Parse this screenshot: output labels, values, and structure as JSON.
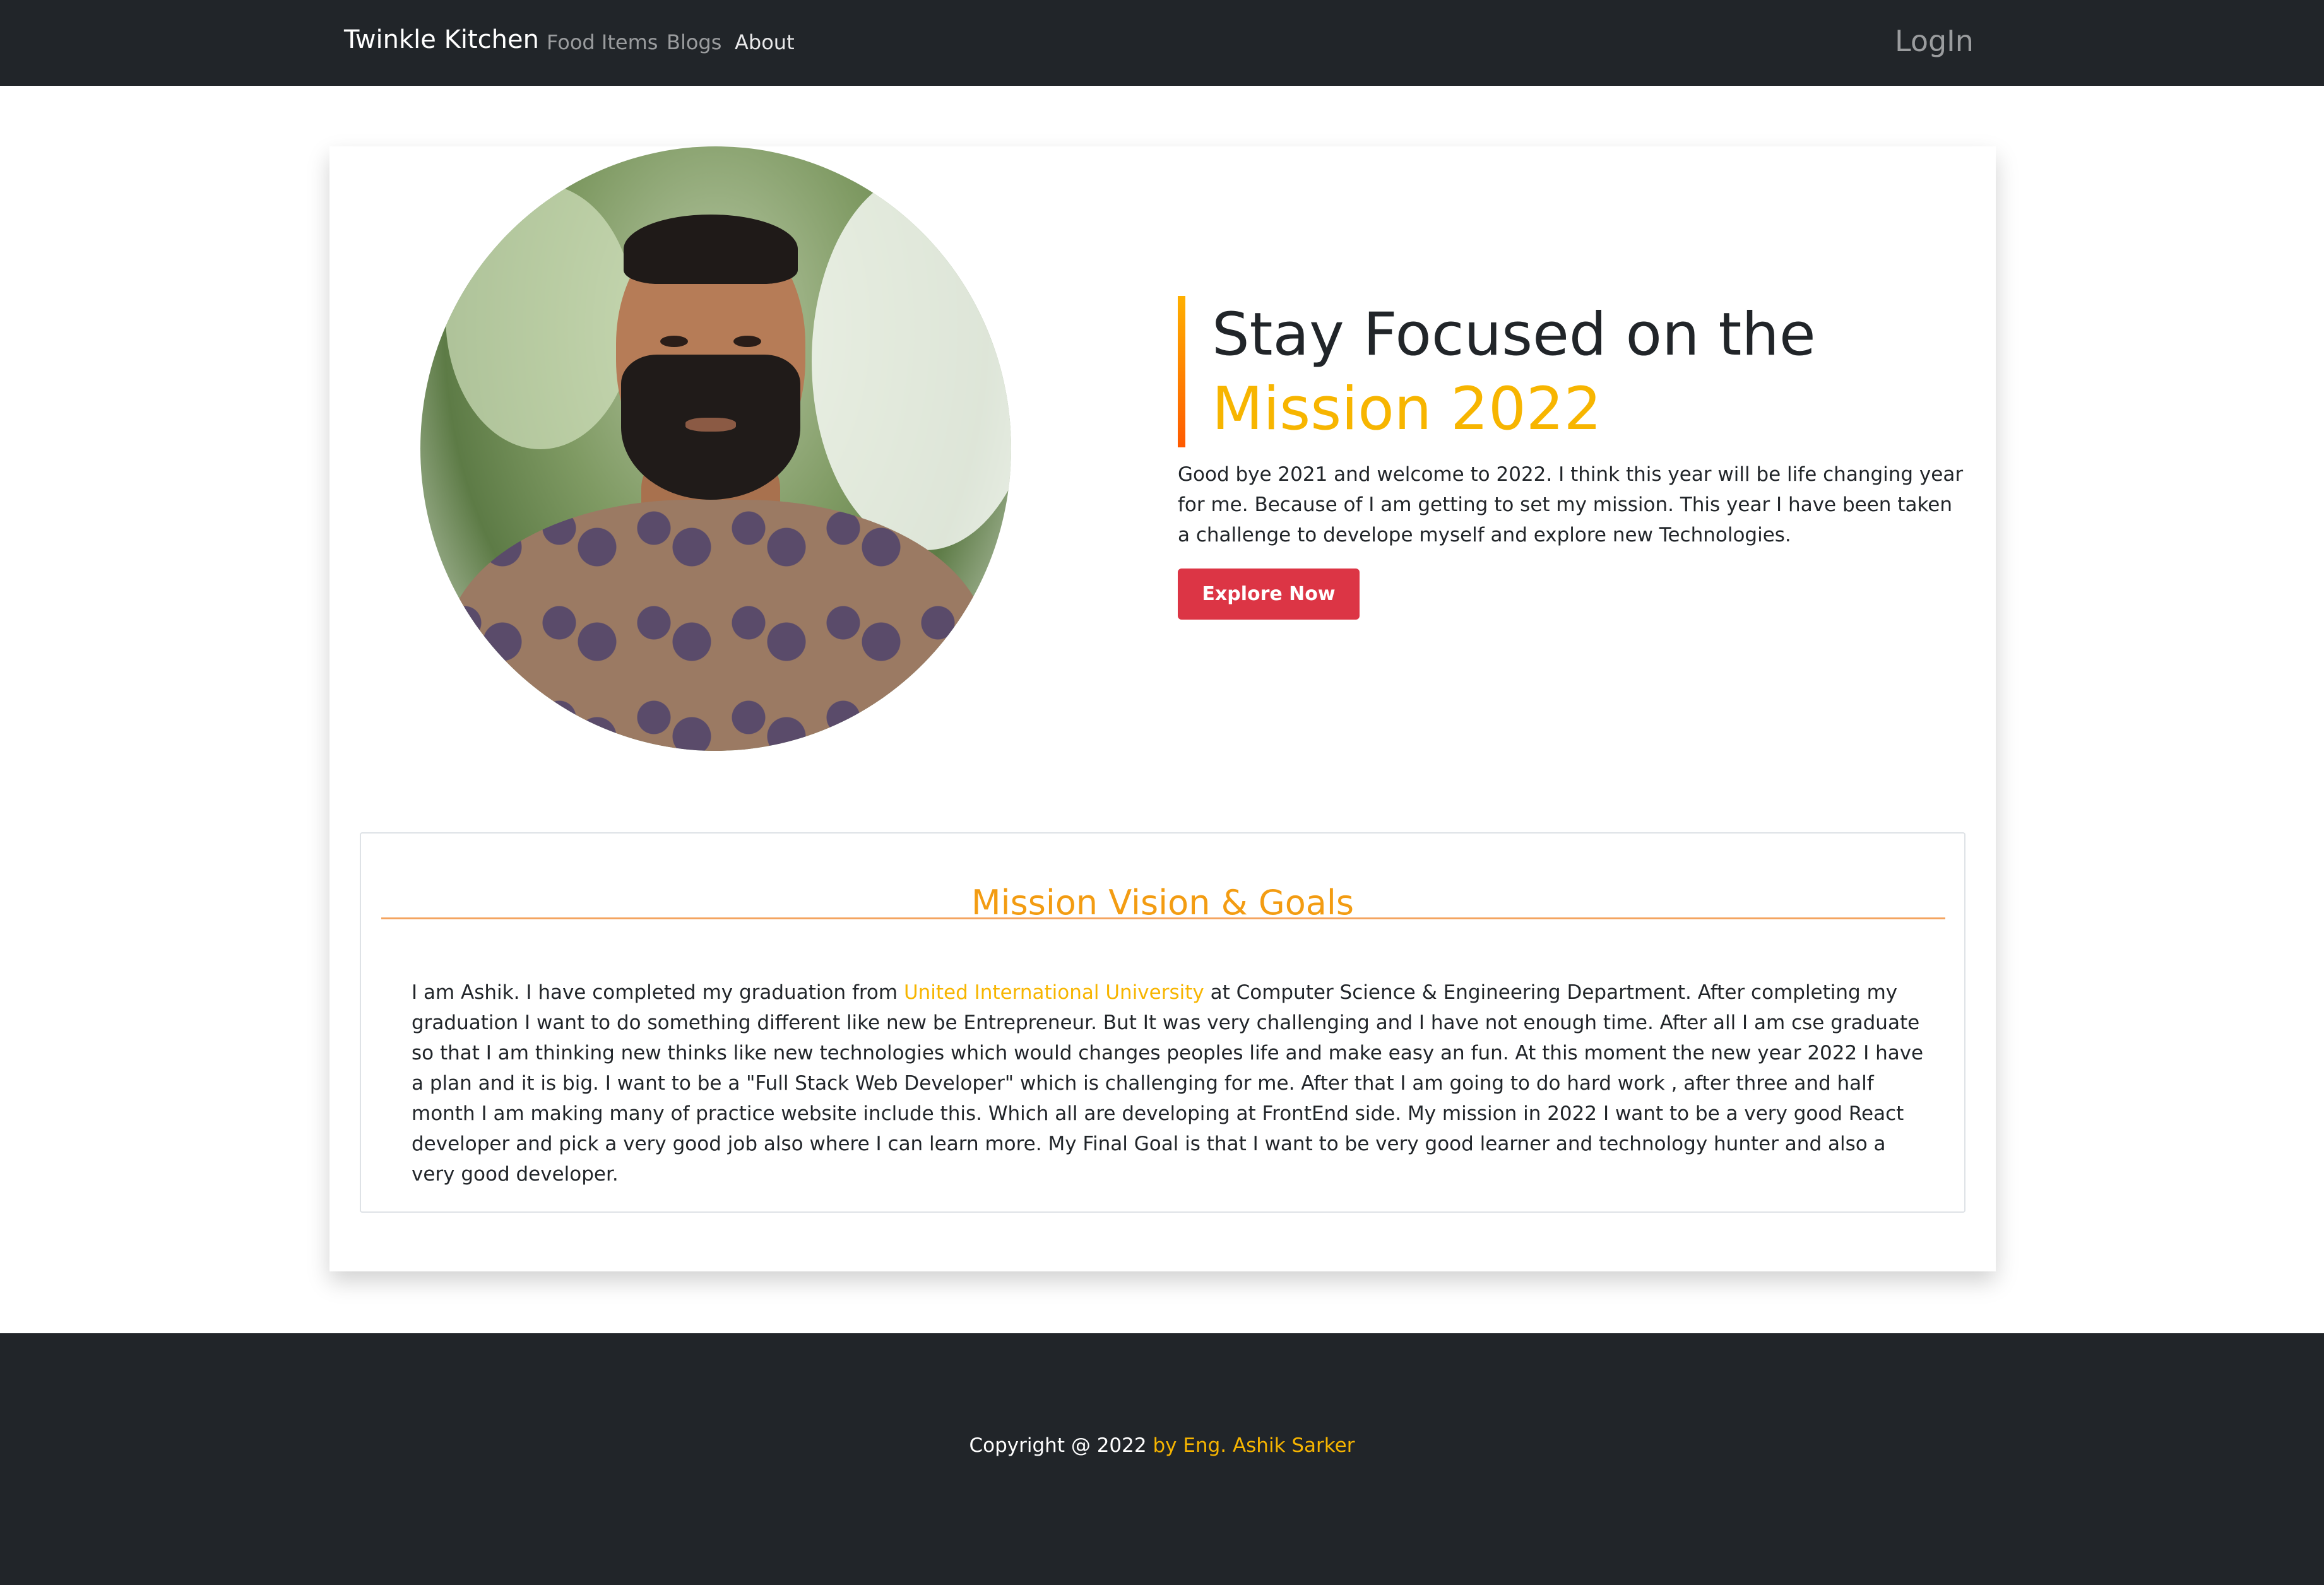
{
  "navbar": {
    "brand": "Twinkle Kitchen",
    "links": [
      "Food Items",
      "Blogs",
      "About"
    ],
    "login": "LogIn"
  },
  "hero": {
    "heading_line1": "Stay Focused on the",
    "heading_line2": "Mission 2022",
    "text": "Good bye 2021 and welcome to 2022. I think this year will be life changing year for me. Because of I am getting to set my mission. This year I have been taken a challenge to develope myself and explore new Technologies.",
    "button": "Explore Now"
  },
  "goals": {
    "title": "Mission Vision & Goals",
    "text_before": "I am Ashik. I have completed my graduation from ",
    "university": "United International University",
    "text_after": " at Computer Science & Engineering Department. After completing my graduation I want to do something different like new be Entrepreneur. But It was very challenging and I have not enough time. After all I am cse graduate so that I am thinking new thinks like new technologies which would changes peoples life and make easy an fun. At this moment the new year 2022 I have a plan and it is big. I want to be a \"Full Stack Web Developer\" which is challenging for me. After that I am going to do hard work , after three and half month I am making many of practice website include this. Which all are developing at FrontEnd side. My mission in 2022 I want to be a very good React developer and pick a very good job also where I can learn more. My Final Goal is that I want to be very good learner and technology hunter and also a very good developer."
  },
  "footer": {
    "copyright": "Copyright @ 2022 ",
    "author": "by Eng. Ashik Sarker"
  },
  "colors": {
    "navbar_bg": "#212529",
    "accent": "#f7b500",
    "button": "#dc3545"
  }
}
